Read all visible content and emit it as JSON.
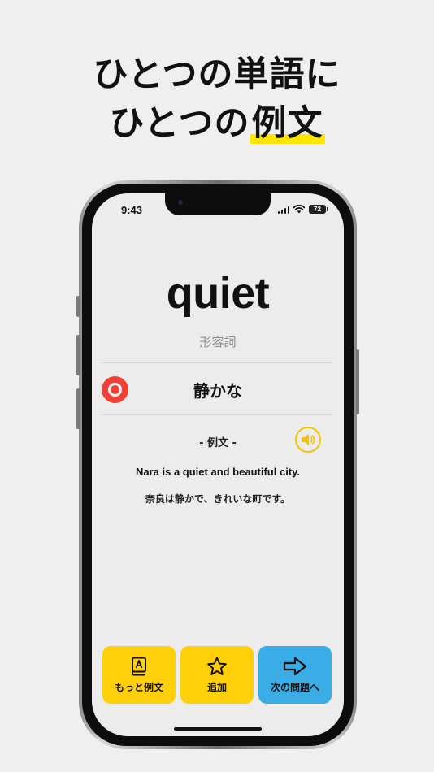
{
  "headline": {
    "line1": "ひとつの単語に",
    "line2_prefix": "ひとつの",
    "line2_highlight": "例文"
  },
  "status_bar": {
    "time": "9:43",
    "battery": "72"
  },
  "card": {
    "word": "quiet",
    "part_of_speech": "形容詞",
    "meaning": "静かな",
    "example_label": "- 例文 -",
    "example_en": "Nara is a quiet and beautiful city.",
    "example_ja": "奈良は静かで、きれいな町です。"
  },
  "buttons": {
    "more_examples": "もっと例文",
    "add": "追加",
    "next": "次の問題へ"
  },
  "colors": {
    "accent_yellow": "#ffcf0a",
    "accent_blue": "#3aace6",
    "correct_red": "#ef4136",
    "highlight": "#ffe600"
  },
  "icons": {
    "mark": "circle-correct-icon",
    "speaker": "speaker-icon",
    "more": "book-a-icon",
    "add": "star-icon",
    "next": "arrow-right-icon"
  }
}
